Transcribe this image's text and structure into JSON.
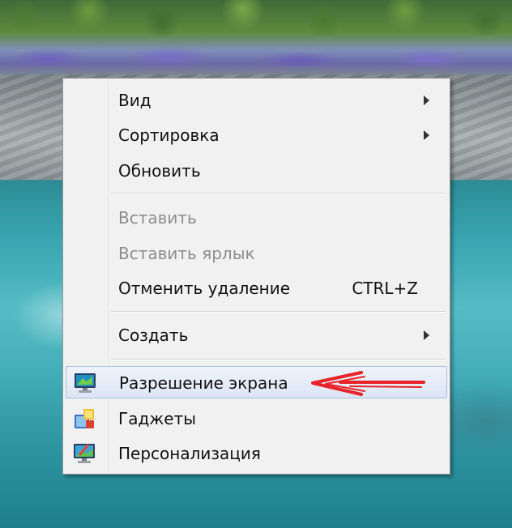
{
  "context_menu": {
    "items": [
      {
        "label": "Вид",
        "has_submenu": true
      },
      {
        "label": "Сортировка",
        "has_submenu": true
      },
      {
        "label": "Обновить"
      },
      {
        "label": "Вставить",
        "disabled": true
      },
      {
        "label": "Вставить ярлык",
        "disabled": true
      },
      {
        "label": "Отменить удаление",
        "shortcut": "CTRL+Z"
      },
      {
        "label": "Создать",
        "has_submenu": true
      },
      {
        "label": "Разрешение экрана",
        "icon": "monitor-icon",
        "highlighted": true
      },
      {
        "label": "Гаджеты",
        "icon": "gadgets-icon"
      },
      {
        "label": "Персонализация",
        "icon": "personalize-icon"
      }
    ]
  },
  "annotation": {
    "arrow_color": "#e8232a",
    "arrow_icon": "red-arrow-icon"
  },
  "colors": {
    "menu_bg": "#f1f1f1",
    "highlight_bg": "#dce6f4",
    "highlight_border": "#a9bedb",
    "disabled_text": "#8d8d8d"
  }
}
